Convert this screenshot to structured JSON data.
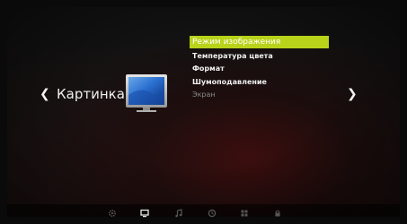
{
  "category": {
    "label": "Картинка",
    "prev_icon": "chevron-left-icon",
    "next_icon": "chevron-right-icon",
    "image_icon": "monitor-icon"
  },
  "menu": {
    "items": [
      {
        "label": "Режим изображения",
        "selected": true
      },
      {
        "label": "Температура цвета",
        "selected": false
      },
      {
        "label": "Формат",
        "selected": false
      },
      {
        "label": "Шумоподавление",
        "selected": false
      },
      {
        "label": "Экран",
        "selected": false
      }
    ]
  },
  "bottom_bar": {
    "icons": [
      "gear-icon",
      "monitor-icon",
      "music-note-icon",
      "clock-icon",
      "grid-icon",
      "lock-icon"
    ],
    "active": "monitor-icon"
  },
  "colors": {
    "highlight": "#b8d31a",
    "text": "#f0f0f0",
    "dim_text": "#8a8a8a"
  }
}
